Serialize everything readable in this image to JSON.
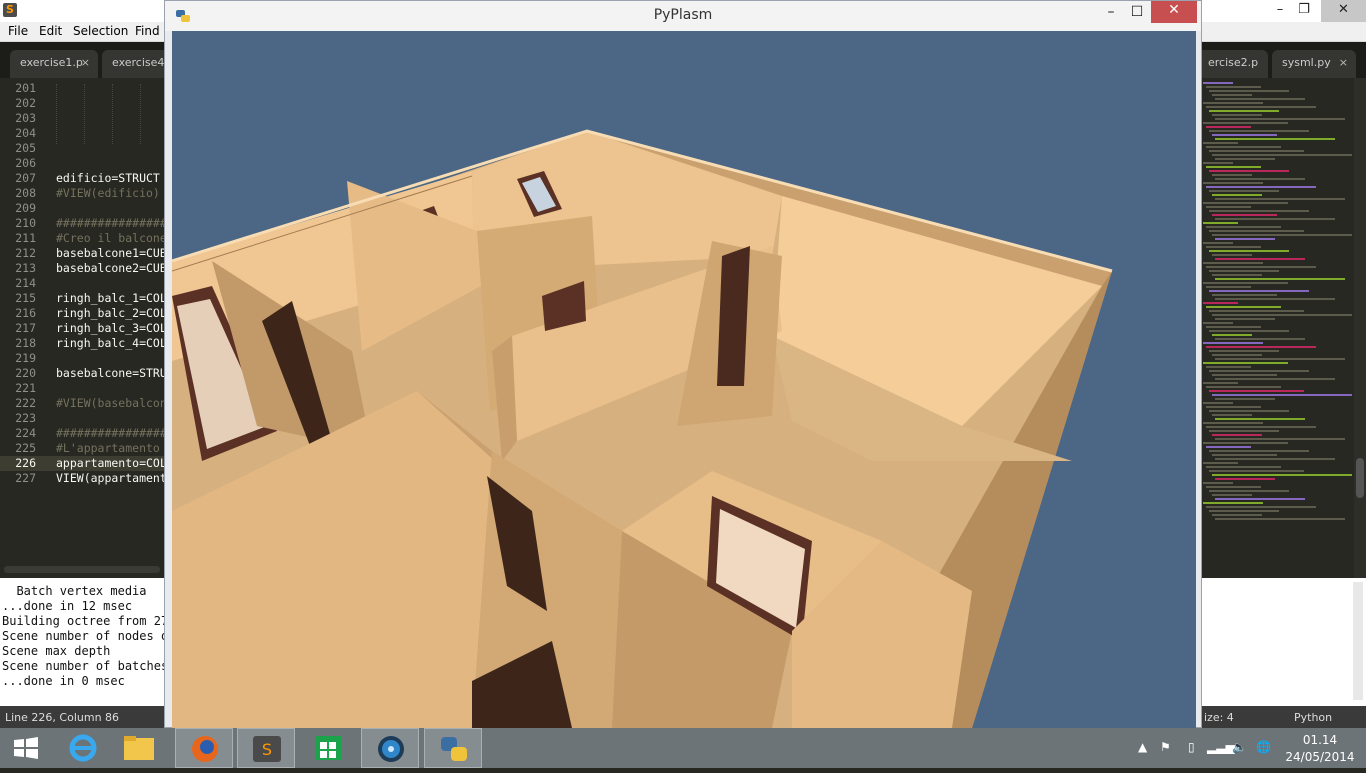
{
  "sublime": {
    "menu": [
      "File",
      "Edit",
      "Selection",
      "Find"
    ],
    "tabs_left": [
      "exercise1.p",
      "exercise4."
    ],
    "tabs_right": [
      "ercise2.p",
      "sysml.py"
    ],
    "close_symbol": "×",
    "lines": [
      {
        "n": "201",
        "code": ""
      },
      {
        "n": "202",
        "code": ""
      },
      {
        "n": "203",
        "code": ""
      },
      {
        "n": "204",
        "code": ""
      },
      {
        "n": "205",
        "code": ""
      },
      {
        "n": "206",
        "code": ""
      },
      {
        "n": "207",
        "code": "edificio=STRUCT"
      },
      {
        "n": "208",
        "code": "#VIEW(edificio)"
      },
      {
        "n": "209",
        "code": ""
      },
      {
        "n": "210",
        "code": "################"
      },
      {
        "n": "211",
        "code": "#Creo il balcone"
      },
      {
        "n": "212",
        "code": "basebalcone1=CUB"
      },
      {
        "n": "213",
        "code": "basebalcone2=CUB"
      },
      {
        "n": "214",
        "code": ""
      },
      {
        "n": "215",
        "code": "ringh_balc_1=COL"
      },
      {
        "n": "216",
        "code": "ringh_balc_2=COL"
      },
      {
        "n": "217",
        "code": "ringh_balc_3=COL"
      },
      {
        "n": "218",
        "code": "ringh_balc_4=COL"
      },
      {
        "n": "219",
        "code": ""
      },
      {
        "n": "220",
        "code": "basebalcone=STRU"
      },
      {
        "n": "221",
        "code": ""
      },
      {
        "n": "222",
        "code": "#VIEW(basebalcon"
      },
      {
        "n": "223",
        "code": ""
      },
      {
        "n": "224",
        "code": "################"
      },
      {
        "n": "225",
        "code": "#L'appartamento"
      },
      {
        "n": "226",
        "code": "appartamento=COL"
      },
      {
        "n": "227",
        "code": "VIEW(appartament"
      }
    ],
    "console": [
      "  Batch vertex media",
      "...done in 12 msec",
      "Building octree from 27",
      "Scene number of nodes o",
      "Scene max depth",
      "Scene number of batches",
      "...done in 0 msec"
    ],
    "status_left": "Line 226, Column 86",
    "status_size": "ize: 4",
    "status_lang": "Python"
  },
  "pyplasm": {
    "title": "PyPlasm",
    "minimize": "–",
    "maximize": "☐",
    "close": "✕"
  },
  "taskbar": {
    "time": "01.14",
    "date": "24/05/2014",
    "apps": [
      "start-icon",
      "internet-explorer-icon",
      "file-explorer-icon",
      "firefox-icon",
      "sublime-text-icon",
      "store-icon",
      "media-app-icon",
      "python-icon"
    ]
  }
}
